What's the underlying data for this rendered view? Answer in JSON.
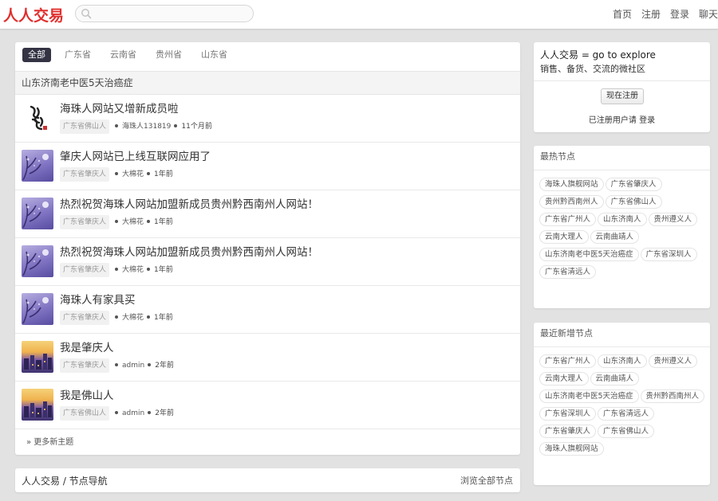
{
  "header": {
    "logo": "人人交易",
    "search_placeholder": "",
    "nav": [
      "首页",
      "注册",
      "登录",
      "聊天"
    ]
  },
  "tabs": [
    "全部",
    "广东省",
    "云南省",
    "贵州省",
    "山东省"
  ],
  "active_tab": "全部",
  "subheader": "山东济南老中医5天治癌症",
  "topics": [
    {
      "title": "海珠人网站又增新成员啦",
      "node": "广东省佛山人",
      "author": "海珠人131819",
      "time": "11个月前",
      "thumb": "calligraphy"
    },
    {
      "title": "肇庆人网站已上线互联网应用了",
      "node": "广东省肇庆人",
      "author": "大棉花",
      "time": "1年前",
      "thumb": "night"
    },
    {
      "title": "热烈祝贺海珠人网站加盟新成员贵州黔西南州人网站！",
      "node": "广东省肇庆人",
      "author": "大棉花",
      "time": "1年前",
      "thumb": "night"
    },
    {
      "title": "热烈祝贺海珠人网站加盟新成员贵州黔西南州人网站！",
      "node": "广东省肇庆人",
      "author": "大棉花",
      "time": "1年前",
      "thumb": "night"
    },
    {
      "title": "海珠人有家具买",
      "node": "广东省肇庆人",
      "author": "大棉花",
      "time": "1年前",
      "thumb": "night"
    },
    {
      "title": "我是肇庆人",
      "node": "广东省肇庆人",
      "author": "admin",
      "time": "2年前",
      "thumb": "city"
    },
    {
      "title": "我是佛山人",
      "node": "广东省佛山人",
      "author": "admin",
      "time": "2年前",
      "thumb": "city"
    }
  ],
  "more_link": "» 更多新主题",
  "node_nav": {
    "left": "人人交易 / 节点导航",
    "right": "浏览全部节点"
  },
  "welcome": {
    "line1": "人人交易 = go to explore",
    "line2": "销售、备货、交流的微社区",
    "signup": "现在注册",
    "login_line": "已注册用户请 登录"
  },
  "hot_nodes": {
    "title": "最热节点",
    "tags": [
      "海珠人旗舰网站",
      "广东省肇庆人",
      "贵州黔西南州人",
      "广东省佛山人",
      "广东省广州人",
      "山东济南人",
      "贵州遵义人",
      "云南大理人",
      "云南曲靖人",
      "山东济南老中医5天治癌症",
      "广东省深圳人",
      "广东省清远人"
    ]
  },
  "new_nodes": {
    "title": "最近新增节点",
    "tags": [
      "广东省广州人",
      "山东济南人",
      "贵州遵义人",
      "云南大理人",
      "云南曲靖人",
      "山东济南老中医5天治癌症",
      "贵州黔西南州人",
      "广东省深圳人",
      "广东省清远人",
      "广东省肇庆人",
      "广东省佛山人",
      "海珠人旗舰网站"
    ]
  },
  "colors": {
    "brand": "#e0302e",
    "active_tab": "#333344",
    "page_bg": "#e2e2e2"
  }
}
